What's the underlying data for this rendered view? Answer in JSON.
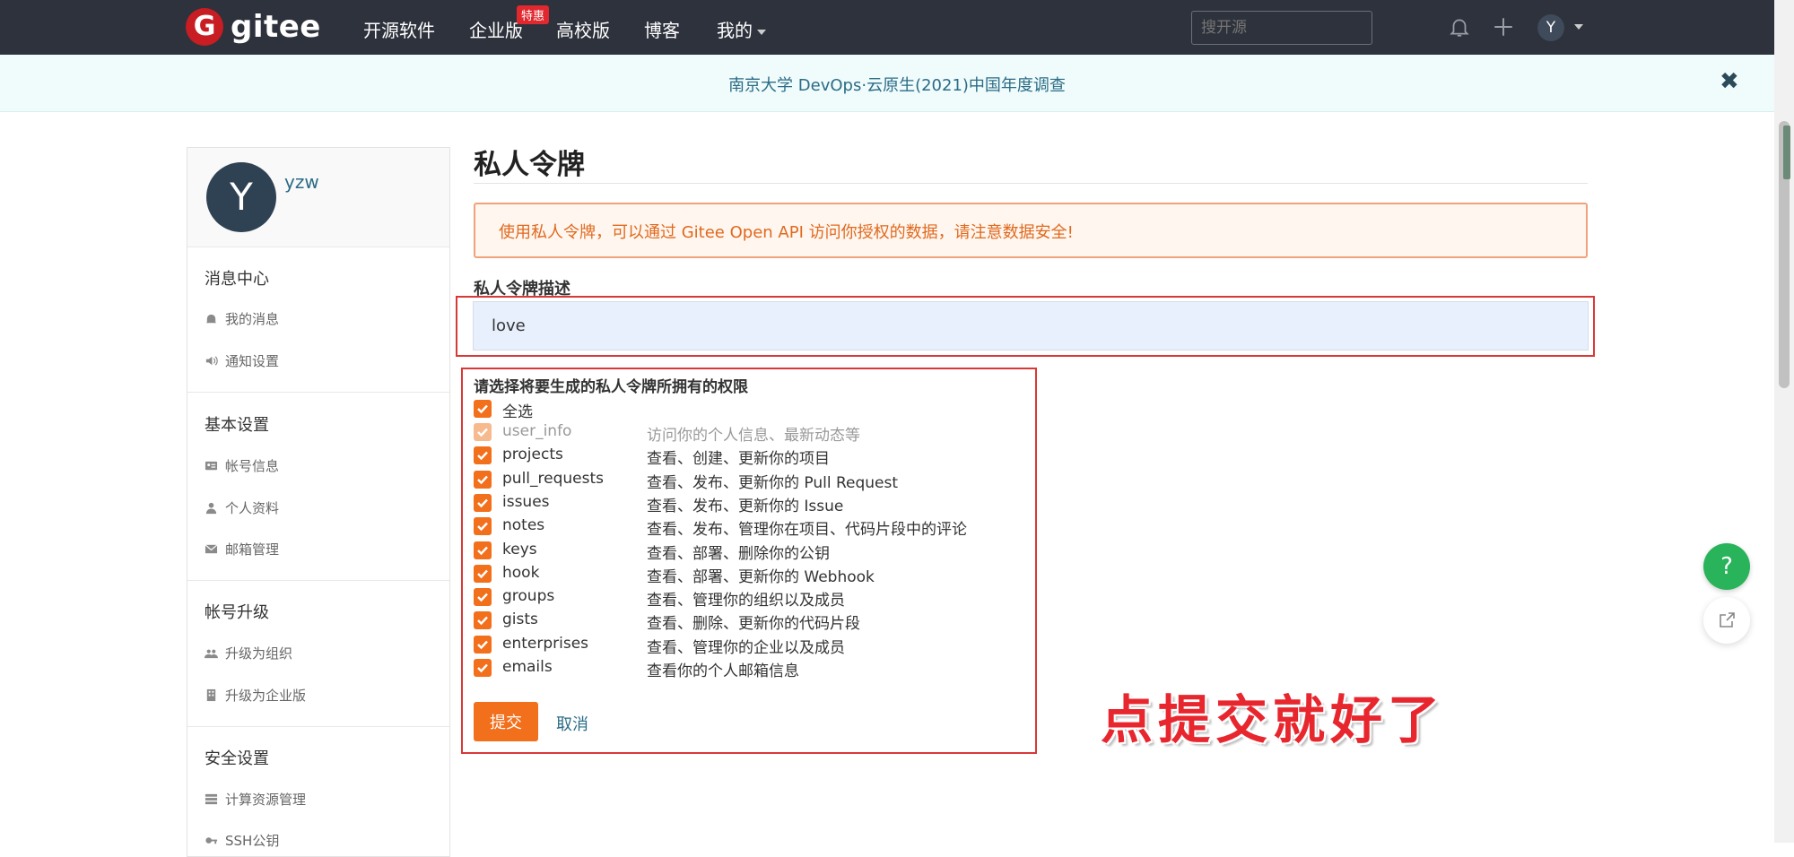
{
  "nav": {
    "logo_letter": "G",
    "logo_text": "gitee",
    "items": [
      "开源软件",
      "企业版",
      "高校版",
      "博客",
      "我的"
    ],
    "hot_badge": "特惠",
    "search_placeholder": "搜开源",
    "avatar_letter": "Y",
    "icons": [
      "bell-icon",
      "plus-icon",
      "chevron-down-icon"
    ]
  },
  "banner": {
    "text": "南京大学 DevOps·云原生(2021)中国年度调查",
    "close": "✖"
  },
  "sidebar": {
    "avatar_letter": "Y",
    "username": "yzw",
    "sections": [
      {
        "title": "消息中心",
        "items": [
          {
            "label": "我的消息",
            "icon": "bell-icon"
          },
          {
            "label": "通知设置",
            "icon": "volume-icon"
          }
        ]
      },
      {
        "title": "基本设置",
        "items": [
          {
            "label": "帐号信息",
            "icon": "id-card-icon"
          },
          {
            "label": "个人资料",
            "icon": "user-icon"
          },
          {
            "label": "邮箱管理",
            "icon": "mail-icon"
          }
        ]
      },
      {
        "title": "帐号升级",
        "items": [
          {
            "label": "升级为组织",
            "icon": "group-icon"
          },
          {
            "label": "升级为企业版",
            "icon": "building-icon"
          }
        ]
      },
      {
        "title": "安全设置",
        "items": [
          {
            "label": "计算资源管理",
            "icon": "server-icon"
          },
          {
            "label": "SSH公钥",
            "icon": "key-icon"
          }
        ]
      }
    ]
  },
  "main": {
    "title": "私人令牌",
    "alert": "使用私人令牌，可以通过 Gitee Open API 访问你授权的数据，请注意数据安全!",
    "desc_label": "私人令牌描述",
    "desc_value": "love",
    "perm_title": "请选择将要生成的私人令牌所拥有的权限",
    "select_all": "全选",
    "permissions": [
      {
        "name": "user_info",
        "desc": "访问你的个人信息、最新动态等",
        "disabled": true
      },
      {
        "name": "projects",
        "desc": "查看、创建、更新你的项目"
      },
      {
        "name": "pull_requests",
        "desc": "查看、发布、更新你的 Pull Request"
      },
      {
        "name": "issues",
        "desc": "查看、发布、更新你的 Issue"
      },
      {
        "name": "notes",
        "desc": "查看、发布、管理你在项目、代码片段中的评论"
      },
      {
        "name": "keys",
        "desc": "查看、部署、删除你的公钥"
      },
      {
        "name": "hook",
        "desc": "查看、部署、更新你的 Webhook"
      },
      {
        "name": "groups",
        "desc": "查看、管理你的组织以及成员"
      },
      {
        "name": "gists",
        "desc": "查看、删除、更新你的代码片段"
      },
      {
        "name": "enterprises",
        "desc": "查看、管理你的企业以及成员"
      },
      {
        "name": "emails",
        "desc": "查看你的个人邮箱信息"
      }
    ],
    "submit": "提交",
    "cancel": "取消",
    "annotation": "点提交就好了"
  },
  "floating": {
    "help": "?"
  },
  "colors": {
    "nav_bg": "#2e323c",
    "accent": "#f26f1c",
    "brand": "#c71d23",
    "highlight": "#d93838"
  }
}
